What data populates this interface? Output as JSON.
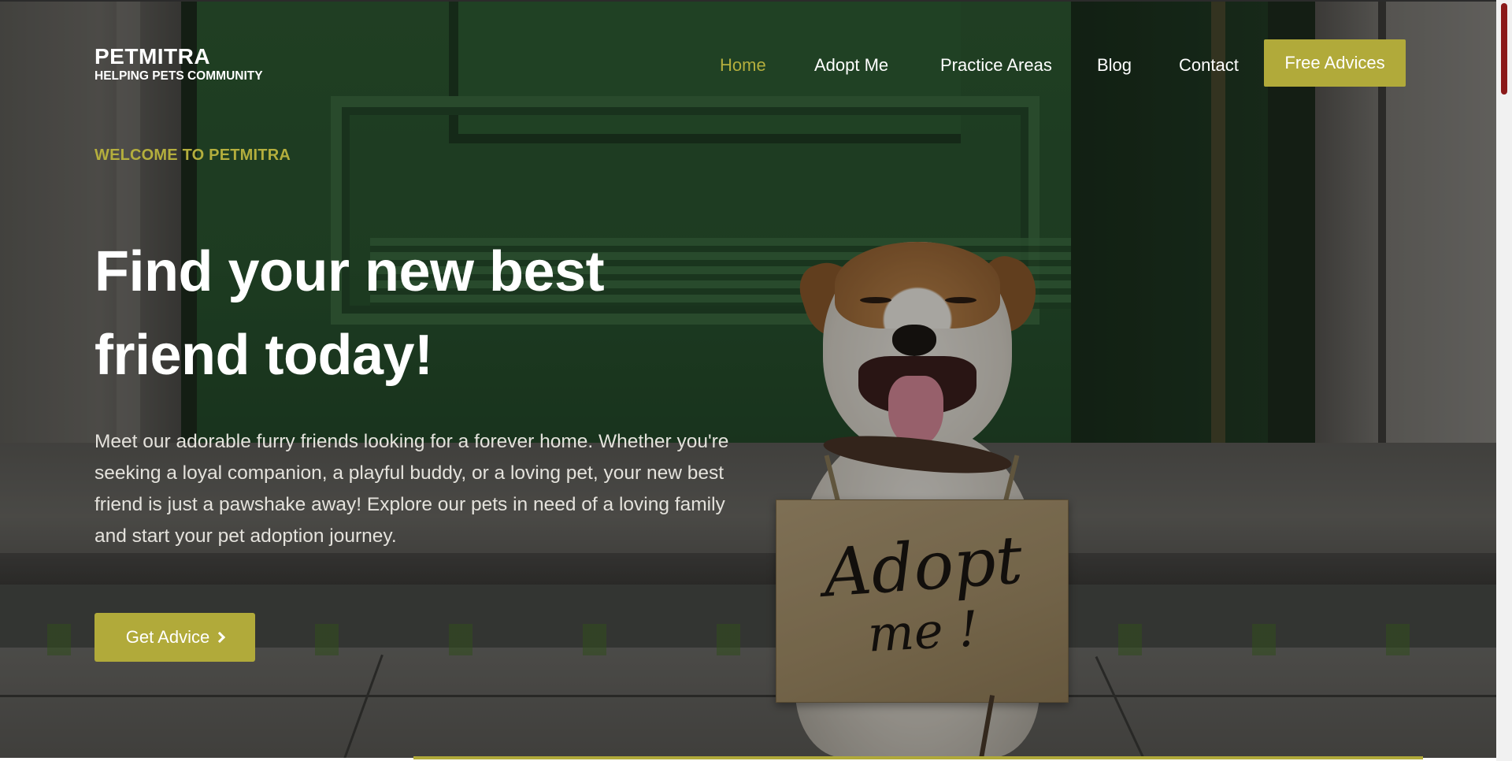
{
  "brand": {
    "name": "PETMITRA",
    "tagline": "HELPING PETS COMMUNITY"
  },
  "nav": {
    "items": [
      {
        "label": "Home",
        "active": true
      },
      {
        "label": "Adopt Me",
        "active": false
      },
      {
        "label": "Practice Areas",
        "active": false
      },
      {
        "label": "Blog",
        "active": false
      },
      {
        "label": "Contact",
        "active": false
      }
    ],
    "cta_label": "Free Advices"
  },
  "hero": {
    "eyebrow": "WELCOME TO PETMITRA",
    "headline_line1": "Find your new best",
    "headline_line2": "friend today!",
    "description": "Meet our adorable furry friends looking for a forever home. Whether you're seeking a loyal companion, a playful buddy, or a loving pet, your new best friend is just a pawshake away! Explore our pets in need of a loving family and start your pet adoption journey.",
    "cta_label": "Get Advice",
    "cta_icon": "chevron-right-icon",
    "sign_line1": "Adopt",
    "sign_line2": "me !"
  },
  "colors": {
    "accent": "#b1aa3a",
    "active_nav": "#b4ae3d",
    "scroll_thumb": "#8b1a1a"
  }
}
